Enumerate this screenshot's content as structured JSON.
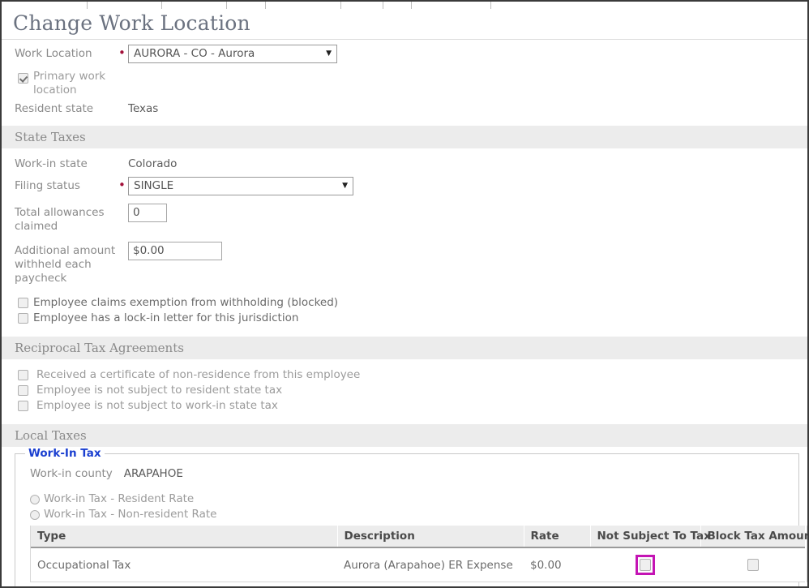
{
  "tabstrip": {
    "tick_positions": [
      105,
      197,
      277,
      325,
      418,
      470,
      505,
      603
    ]
  },
  "page": {
    "title": "Change Work Location",
    "required_marker": "•",
    "caret_glyph": "▼"
  },
  "work_location": {
    "label": "Work Location",
    "value": "AURORA - CO - Aurora",
    "primary_checkbox_label": "Primary work location",
    "primary_checked": true,
    "resident_state_label": "Resident state",
    "resident_state_value": "Texas"
  },
  "state_taxes": {
    "band_title": "State Taxes",
    "work_in_state_label": "Work-in state",
    "work_in_state_value": "Colorado",
    "filing_status_label": "Filing status",
    "filing_status_value": "SINGLE",
    "total_allowances_label": "Total allowances claimed",
    "total_allowances_value": "0",
    "additional_amount_label": "Additional amount withheld each paycheck",
    "additional_amount_value": "$0.00",
    "checkboxes": [
      {
        "label": "Employee claims exemption from withholding (blocked)",
        "checked": false
      },
      {
        "label": "Employee has a lock-in letter for this jurisdiction",
        "checked": false
      }
    ]
  },
  "reciprocal": {
    "band_title": "Reciprocal Tax Agreements",
    "checkboxes": [
      {
        "label": "Received a certificate of non-residence from this employee",
        "checked": false
      },
      {
        "label": "Employee is not subject to resident state tax",
        "checked": false
      },
      {
        "label": "Employee is not subject to work-in state tax",
        "checked": false
      }
    ]
  },
  "local_taxes": {
    "band_title": "Local Taxes",
    "fieldset_legend": "Work-In Tax",
    "county_label": "Work-in county",
    "county_value": "ARAPAHOE",
    "radios": [
      {
        "label": "Work-in Tax - Resident Rate",
        "selected": false
      },
      {
        "label": "Work-in Tax - Non-resident Rate",
        "selected": false
      }
    ],
    "table": {
      "columns": [
        "Type",
        "Description",
        "Rate",
        "Not Subject To Tax",
        "Block Tax Amount"
      ],
      "rows": [
        {
          "type": "Occupational Tax",
          "description": "Aurora (Arapahoe) ER Expense",
          "rate": "$0.00",
          "not_subject_to_tax": false,
          "block_tax_amount": false,
          "not_subject_highlighted": true
        }
      ]
    }
  },
  "colors": {
    "highlight": "#c414b4",
    "legend_blue": "#1a3fd0",
    "band_grey": "#ececec",
    "required_red": "#a3113a"
  }
}
